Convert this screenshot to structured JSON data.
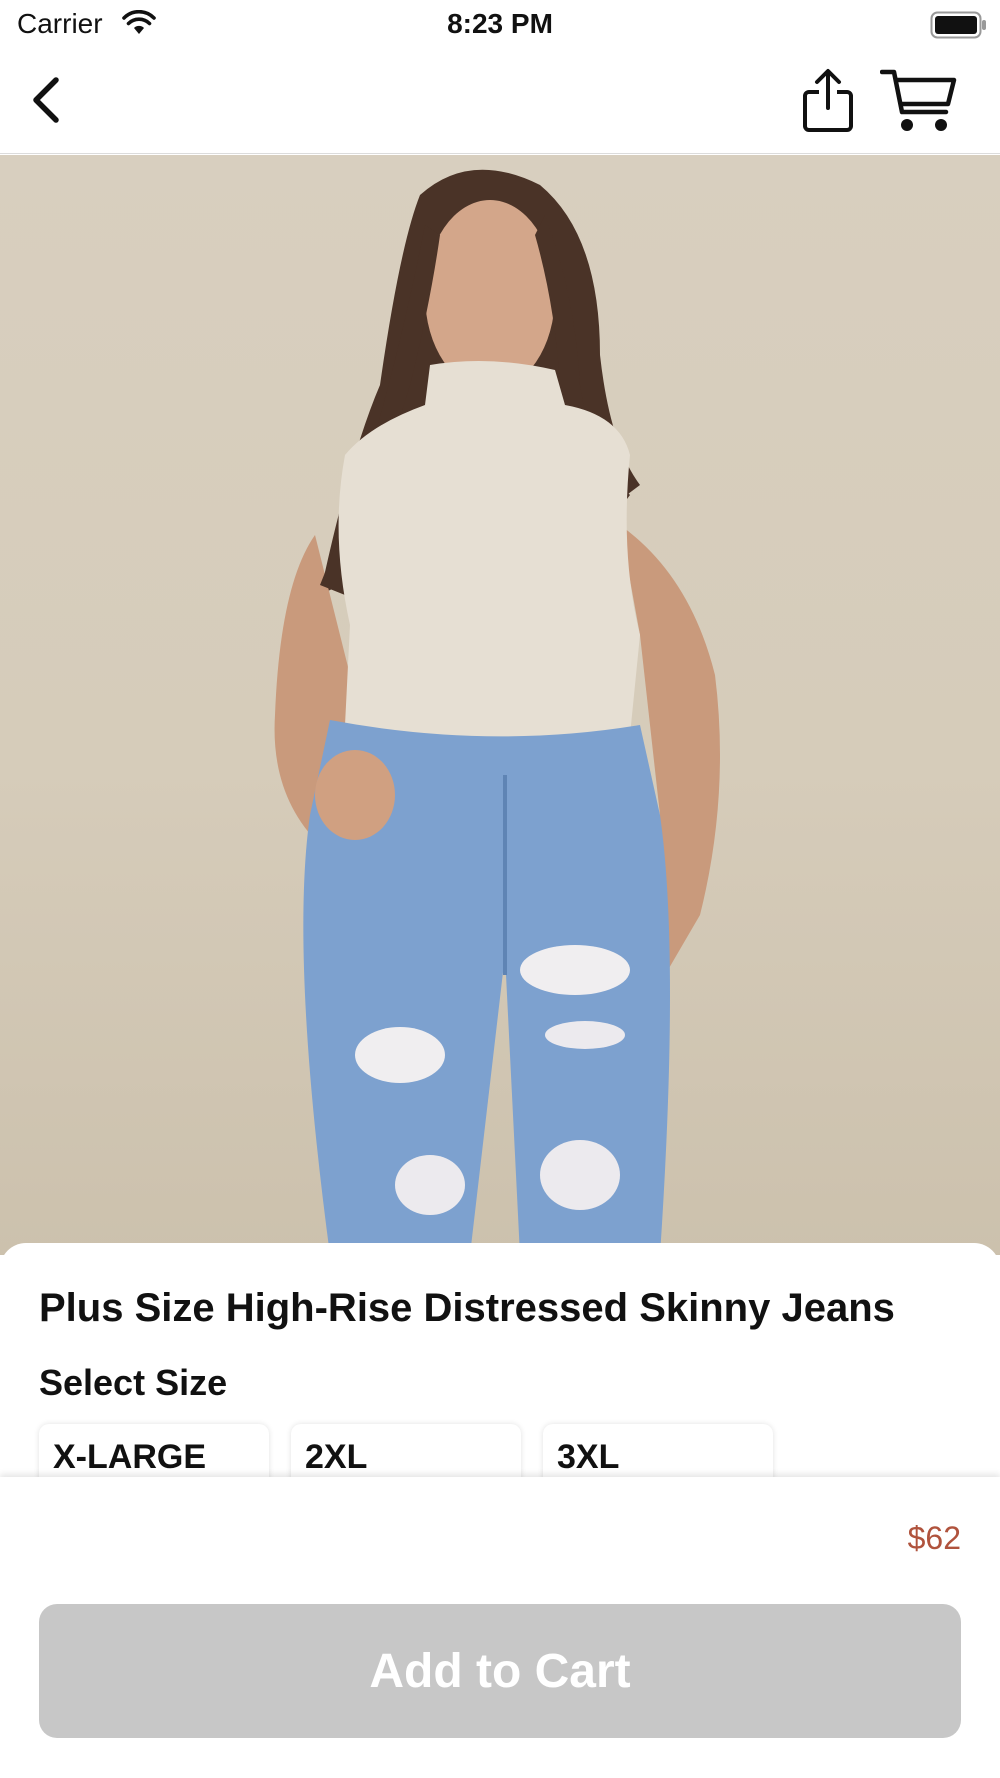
{
  "status_bar": {
    "carrier": "Carrier",
    "time": "8:23 PM",
    "icons": [
      "wifi-icon",
      "battery-icon"
    ]
  },
  "nav": {
    "icons": [
      "chevron-left-icon",
      "share-icon",
      "cart-icon"
    ]
  },
  "product": {
    "image": "product-photo",
    "title": "Plus Size High-Rise Distressed Skinny Jeans",
    "select_size_label": "Select Size",
    "sizes": [
      "X-LARGE",
      "2XL",
      "3XL"
    ],
    "price": "$62"
  },
  "actions": {
    "add_to_cart_label": "Add to Cart"
  },
  "colors": {
    "price": "#b0533d",
    "button_disabled": "#c7c7c7",
    "photo_bg": "#d6ccba"
  }
}
